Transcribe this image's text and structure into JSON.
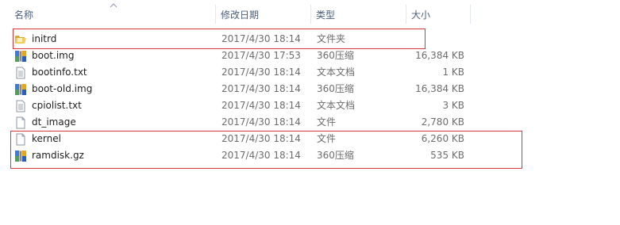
{
  "columns": {
    "name": "名称",
    "date": "修改日期",
    "type": "类型",
    "size": "大小"
  },
  "sort_icon": "sort-ascending-icon",
  "files": [
    {
      "name": "initrd",
      "date": "2017/4/30 18:14",
      "type": "文件夹",
      "size": "",
      "icon": "folder-icon"
    },
    {
      "name": "boot.img",
      "date": "2017/4/30 17:53",
      "type": "360压缩",
      "size": "16,384 KB",
      "icon": "archive-icon"
    },
    {
      "name": "bootinfo.txt",
      "date": "2017/4/30 18:14",
      "type": "文本文档",
      "size": "1 KB",
      "icon": "text-file-icon"
    },
    {
      "name": "boot-old.img",
      "date": "2017/4/30 18:14",
      "type": "360压缩",
      "size": "16,384 KB",
      "icon": "archive-icon"
    },
    {
      "name": "cpiolist.txt",
      "date": "2017/4/30 18:14",
      "type": "文本文档",
      "size": "3 KB",
      "icon": "text-file-icon"
    },
    {
      "name": "dt_image",
      "date": "2017/4/30 18:14",
      "type": "文件",
      "size": "2,780 KB",
      "icon": "blank-file-icon"
    },
    {
      "name": "kernel",
      "date": "2017/4/30 18:14",
      "type": "文件",
      "size": "6,260 KB",
      "icon": "blank-file-icon"
    },
    {
      "name": "ramdisk.gz",
      "date": "2017/4/30 18:14",
      "type": "360压缩",
      "size": "535 KB",
      "icon": "archive-icon"
    }
  ],
  "colors": {
    "highlight_border": "#e0353a",
    "header_text": "#4c607a",
    "secondary_text": "#6d6d6d"
  }
}
